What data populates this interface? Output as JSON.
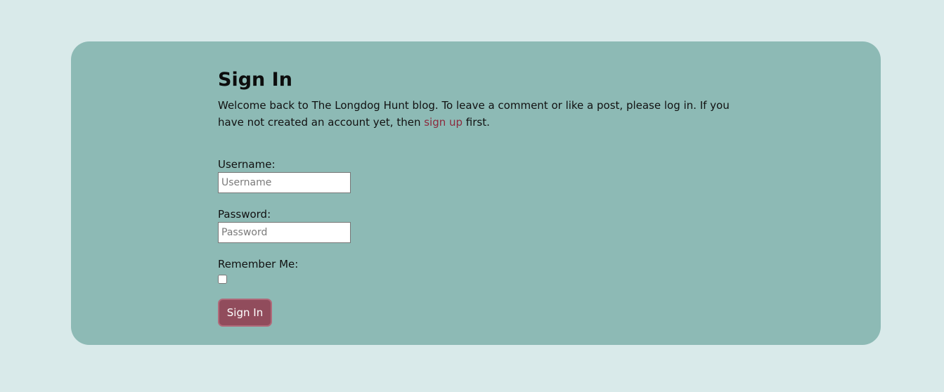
{
  "signin": {
    "title": "Sign In",
    "intro_before": "Welcome back to The Longdog Hunt blog. To leave a comment or like a post, please log in. If you have not created an account yet, then ",
    "signup_link": "sign up",
    "intro_after": " first.",
    "username_label": "Username:",
    "username_placeholder": "Username",
    "username_value": "",
    "password_label": "Password:",
    "password_placeholder": "Password",
    "password_value": "",
    "remember_label": "Remember Me:",
    "remember_checked": false,
    "submit_label": "Sign In"
  },
  "colors": {
    "page_background": "#d9eaea",
    "card_background": "#8dbab5",
    "link": "#8c2a3d",
    "button": "#914c5c"
  }
}
